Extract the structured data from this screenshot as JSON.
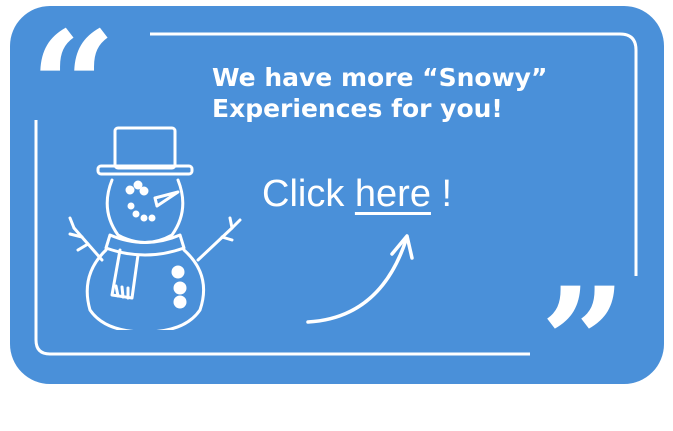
{
  "banner": {
    "headline_line1": "We have more “Snowy”",
    "headline_line2": "Experiences for you!",
    "cta_prefix": "Click ",
    "cta_link": "here",
    "cta_suffix": " !",
    "open_quote": "“",
    "close_quote": "”"
  },
  "colors": {
    "background": "#4a90d9",
    "foreground": "#ffffff"
  },
  "icons": {
    "illustration": "snowman-icon",
    "pointer": "curved-arrow-icon"
  }
}
